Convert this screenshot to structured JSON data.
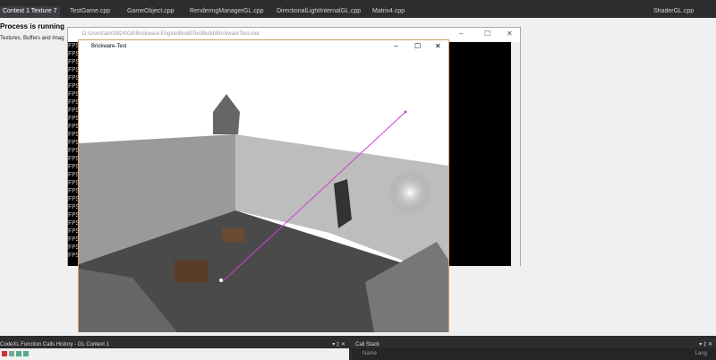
{
  "tabs": [
    "Context 1 Texture 7",
    "TestGame.cpp",
    "GameObject.cpp",
    "RenderingManagerGL.cpp",
    "DirectionalLightInternalGL.cpp",
    "Matrix4.cpp",
    "ShaderGL.cpp"
  ],
  "document": {
    "status": "Process is running",
    "subtitle": "Textures, Buffers and Imag"
  },
  "console": {
    "title": "D:\\Users\\amt3824\\Git\\Brickware-Engine\\Build\\TestBuild\\BrickwareTest.exe",
    "line": "FPS"
  },
  "game": {
    "title": "Brickware-Test"
  },
  "controls": {
    "minimize": "–",
    "maximize": "☐",
    "close": "✕"
  },
  "bottom": {
    "history_title": "CodeXL Function Calls History - GL Context 1",
    "callstack_title": "Call Stack",
    "name_col": "Name",
    "lang_col": "Lang",
    "pin": "▾ ‡ ✕"
  }
}
